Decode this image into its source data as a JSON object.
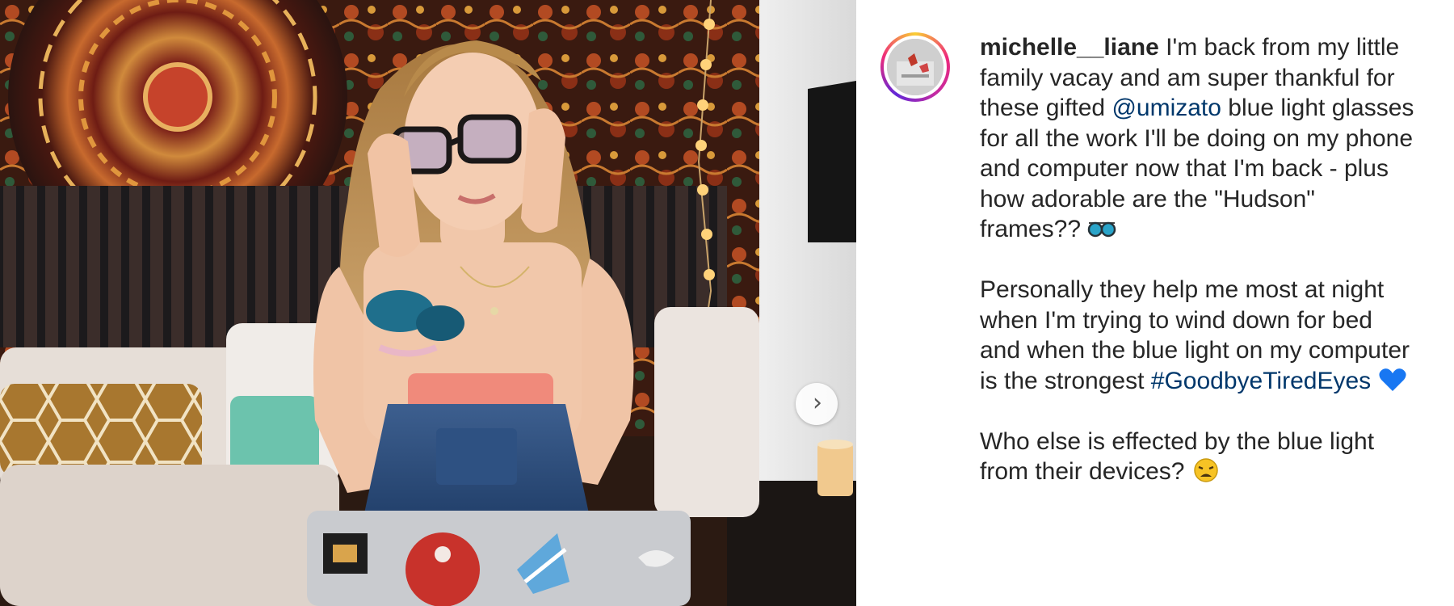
{
  "post": {
    "username": "michelle__liane",
    "caption": {
      "p1_part1": " I'm back from my little family vacay and am super thankful for these gifted ",
      "mention": "@umizato",
      "p1_part2": " blue light glasses for all the work I'll be doing on my phone and computer now that I'm back - plus how adorable are the \"Hudson\" frames?? ",
      "p2_text": "Personally they help me most at night when I'm trying to wind down for bed and when the blue light on my computer is the strongest ",
      "hashtag": "#GoodbyeTiredEyes",
      "p3_text": "Who else is effected by the blue light from their devices? "
    },
    "emojis": [
      "sunglasses-emoji",
      "blue-heart-emoji",
      "weary-face-emoji"
    ],
    "next_arrow_glyph": "›",
    "colors": {
      "link": "#00376b",
      "text": "#262626",
      "heart": "#1877f2"
    }
  }
}
